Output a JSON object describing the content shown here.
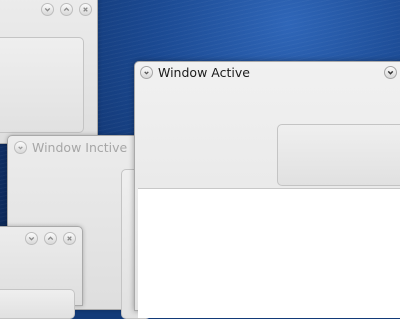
{
  "desktop": {
    "description": ""
  },
  "windows": {
    "back_top": {
      "title": ""
    },
    "inactive": {
      "title": "Window Inctive"
    },
    "bottom_small": {
      "title": ""
    },
    "active": {
      "title": "Window Active"
    }
  },
  "icons": {
    "menu": "window-menu-icon",
    "minimize": "minimize-icon",
    "maximize": "maximize-icon",
    "close": "close-icon"
  },
  "colors": {
    "desktop_blue": "#1b4a93",
    "window_face": "#e6e6e6",
    "active_title_text": "#1b1b1b",
    "inactive_title_text": "#a6a6a6"
  }
}
